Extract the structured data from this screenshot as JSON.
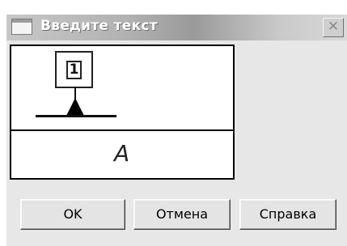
{
  "window": {
    "title": "Введите текст",
    "close_glyph": "✕"
  },
  "preview": {
    "marker_number": "1",
    "text_value": "A"
  },
  "buttons": {
    "ok": "OK",
    "cancel": "Отмена",
    "help": "Справка"
  },
  "icons": {
    "title": "window-icon",
    "close": "close-icon"
  }
}
